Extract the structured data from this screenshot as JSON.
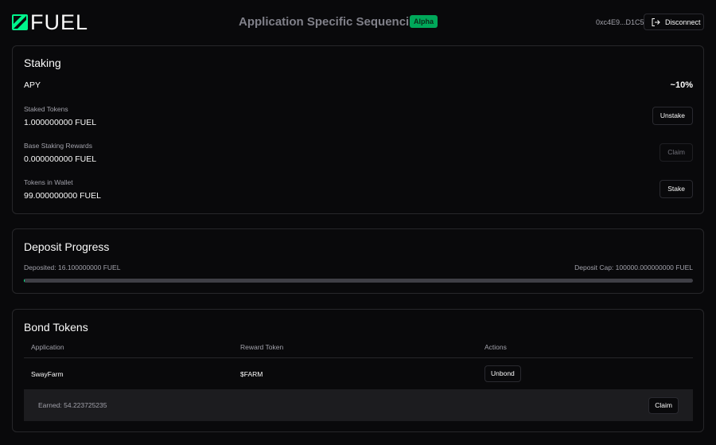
{
  "header": {
    "logo_text": "FUEL",
    "title": "Application Specific Sequencing",
    "badge": "Alpha",
    "wallet_address": "0xc4E9...D1C5",
    "disconnect_label": "Disconnect"
  },
  "staking": {
    "title": "Staking",
    "apy_label": "APY",
    "apy_value": "~10%",
    "rows": [
      {
        "label": "Staked Tokens",
        "value": "1.000000000 FUEL",
        "action": "Unstake"
      },
      {
        "label": "Base Staking Rewards",
        "value": "0.000000000 FUEL",
        "action": "Claim"
      },
      {
        "label": "Tokens in Wallet",
        "value": "99.000000000 FUEL",
        "action": "Stake"
      }
    ]
  },
  "deposit": {
    "title": "Deposit Progress",
    "deposited": "Deposited: 16.100000000 FUEL",
    "cap": "Deposit Cap: 100000.000000000 FUEL",
    "progress_fraction": 0.000161
  },
  "bond": {
    "title": "Bond Tokens",
    "columns": [
      "Application",
      "Reward Token",
      "Actions"
    ],
    "rows": [
      {
        "application": "SwayFarm",
        "reward_token": "$FARM",
        "action": "Unbond",
        "earned": "Earned: 54.223725235",
        "claim": "Claim"
      }
    ]
  },
  "colors": {
    "accent": "#00f58c",
    "badge_bg": "#00a85a",
    "background": "#09090b",
    "border": "#27272a"
  }
}
